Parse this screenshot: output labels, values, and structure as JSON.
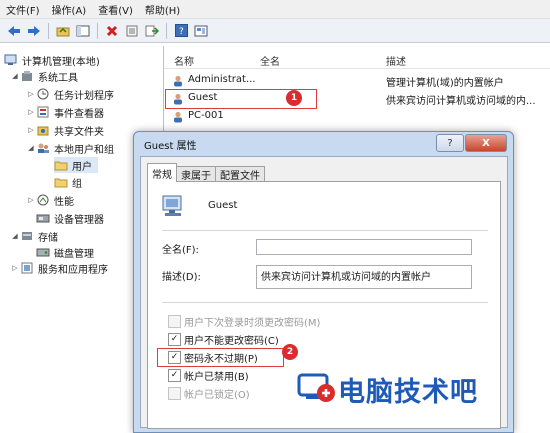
{
  "menu": [
    "文件(F)",
    "操作(A)",
    "查看(V)",
    "帮助(H)"
  ],
  "toolbar_icons": [
    "back-arrow-icon",
    "forward-arrow-icon",
    "up-folder-icon",
    "console-tree-icon",
    "delete-icon",
    "properties-icon",
    "export-icon",
    "help-icon",
    "view-icon"
  ],
  "tree": {
    "root": "计算机管理(本地)",
    "system_tools": "系统工具",
    "task_scheduler": "任务计划程序",
    "event_viewer": "事件查看器",
    "shared_folders": "共享文件夹",
    "local_users_groups": "本地用户和组",
    "users": "用户",
    "groups": "组",
    "performance": "性能",
    "device_manager": "设备管理器",
    "storage": "存储",
    "disk_management": "磁盘管理",
    "services_apps": "服务和应用程序"
  },
  "list": {
    "columns": [
      "名称",
      "全名",
      "描述"
    ],
    "rows": [
      {
        "name": "Administrat...",
        "fullname": "",
        "desc": "管理计算机(域)的内置帐户"
      },
      {
        "name": "Guest",
        "fullname": "",
        "desc": "供来宾访问计算机或访问域的内..."
      },
      {
        "name": "PC-001",
        "fullname": "",
        "desc": ""
      }
    ]
  },
  "badges": [
    "1",
    "2"
  ],
  "dialog": {
    "title": "Guest 属性",
    "help_btn": "?",
    "close_btn": "X",
    "tabs": [
      "常规",
      "隶属于",
      "配置文件"
    ],
    "username": "Guest",
    "fullname_label": "全名(F):",
    "fullname_value": "",
    "desc_label": "描述(D):",
    "desc_value": "供来宾访问计算机或访问域的内置帐户",
    "checkboxes": [
      {
        "label": "用户下次登录时须更改密码(M)",
        "checked": false,
        "disabled": true
      },
      {
        "label": "用户不能更改密码(C)",
        "checked": true,
        "disabled": false
      },
      {
        "label": "密码永不过期(P)",
        "checked": true,
        "disabled": false
      },
      {
        "label": "帐户已禁用(B)",
        "checked": true,
        "disabled": false
      },
      {
        "label": "帐户已锁定(O)",
        "checked": false,
        "disabled": true
      }
    ]
  },
  "watermark": "电脑技术吧",
  "colors": {
    "badge": "#d92c2c",
    "highlight": "#e23b3b",
    "watermark": "#1e5bb8",
    "dialog_frame": "#c8daf0"
  }
}
